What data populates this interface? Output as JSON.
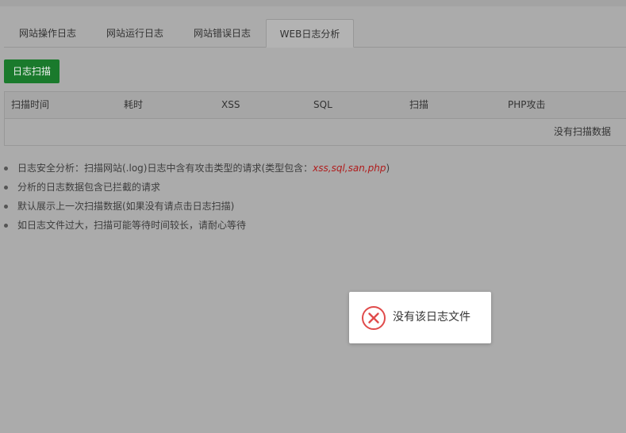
{
  "tabs": [
    {
      "label": "网站操作日志"
    },
    {
      "label": "网站运行日志"
    },
    {
      "label": "网站错误日志"
    },
    {
      "label": "WEB日志分析"
    }
  ],
  "scan_button": {
    "label": "日志扫描"
  },
  "table": {
    "columns": [
      "扫描时间",
      "耗时",
      "XSS",
      "SQL",
      "扫描",
      "PHP攻击"
    ],
    "empty_text": "没有扫描数据"
  },
  "notes": {
    "n1_prefix": "日志安全分析：扫描网站(.log)日志中含有攻击类型的请求(类型包含：",
    "n1_types": "xss,sql,san,php",
    "n1_suffix": ")",
    "n2": "分析的日志数据包含已拦截的请求",
    "n3": "默认展示上一次扫描数据(如果没有请点击日志扫描)",
    "n4": "如日志文件过大，扫描可能等待时间较长，请耐心等待"
  },
  "toast": {
    "message": "没有该日志文件",
    "icon": "error-circle-icon"
  },
  "colors": {
    "accent": "#1a7a2c",
    "error": "#e04b4b",
    "types": "#b01c1c"
  }
}
